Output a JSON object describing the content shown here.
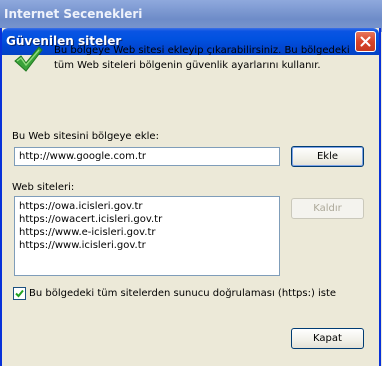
{
  "parent_window": {
    "title": "Internet Secenekleri"
  },
  "dialog": {
    "title": "Güvenilen siteler",
    "description": "Bu bölgeye Web sitesi ekleyip çıkarabilirsiniz. Bu bölgedeki tüm Web siteleri bölgenin güvenlik ayarlarını kullanır.",
    "add_label": "Bu Web sitesini bölgeye ekle:",
    "add_input_value": "http://www.google.com.tr",
    "add_button": "Ekle",
    "sites_label": "Web siteleri:",
    "sites": [
      "https://owa.icisleri.gov.tr",
      "https://owacert.icisleri.gov.tr",
      "https://www.e-icisleri.gov.tr",
      "https://www.icisleri.gov.tr"
    ],
    "remove_button": "Kaldır",
    "require_https_label": "Bu bölgedeki tüm sitelerden sunucu doğrulaması (https:) iste",
    "require_https_checked": true,
    "close_button": "Kapat"
  }
}
